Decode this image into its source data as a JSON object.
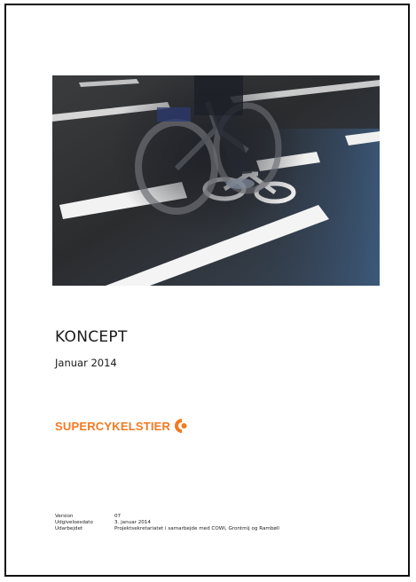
{
  "document": {
    "title": "KONCEPT",
    "date": "Januar 2014",
    "logo_text": "SUPERCYKELSTIER",
    "logo_icon": "supercykelstier-logo-icon",
    "brand_color": "#f47920",
    "cover_image": "cyclist-on-bike-lane-photo",
    "meta": [
      {
        "key": "Version",
        "value": "07"
      },
      {
        "key": "Udgivelsesdato",
        "value": "3. januar 2014"
      },
      {
        "key": "Udarbejdet",
        "value": "Projektsekretariatet i samarbejde med COWI, Grontmij og Rambøll"
      }
    ]
  }
}
